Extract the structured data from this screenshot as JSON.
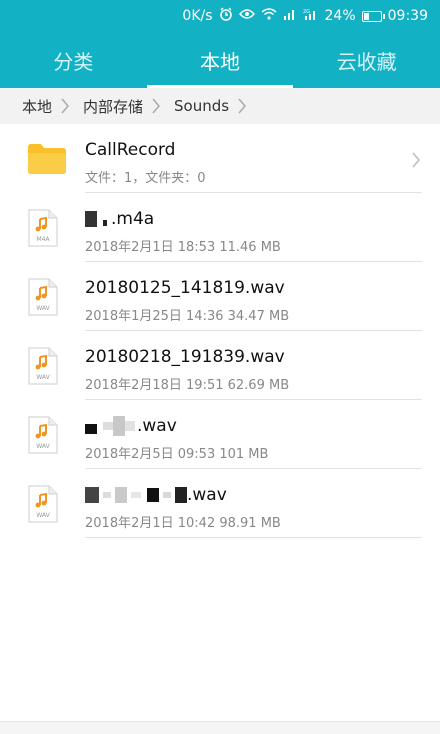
{
  "status": {
    "speed": "0K/s",
    "signal_label": "2G",
    "battery": "24%",
    "time": "09:39"
  },
  "tabs": [
    {
      "label": "分类",
      "active": false
    },
    {
      "label": "本地",
      "active": true
    },
    {
      "label": "云收藏",
      "active": false
    }
  ],
  "breadcrumb": [
    "本地",
    "内部存储",
    "Sounds"
  ],
  "files": [
    {
      "type": "folder",
      "name": "CallRecord",
      "detail": "文件：1，文件夹：0"
    },
    {
      "type": "m4a",
      "name": ".m4a",
      "detail": "2018年2月1日 18:53 11.46 MB"
    },
    {
      "type": "wav",
      "name": "20180125_141819.wav",
      "detail": "2018年1月25日 14:36 34.47 MB"
    },
    {
      "type": "wav",
      "name": "20180218_191839.wav",
      "detail": "2018年2月18日 19:51 62.69 MB"
    },
    {
      "type": "wav",
      "name": ".wav",
      "detail": "2018年2月5日 09:53 101 MB"
    },
    {
      "type": "wav",
      "name": ".wav",
      "detail": "2018年2月1日 10:42 98.91 MB"
    }
  ],
  "icon_labels": {
    "m4a": "M4A",
    "wav": "WAV"
  },
  "colors": {
    "header": "#12b1c4",
    "folder": "#f9c02c",
    "music_note": "#f29422"
  }
}
